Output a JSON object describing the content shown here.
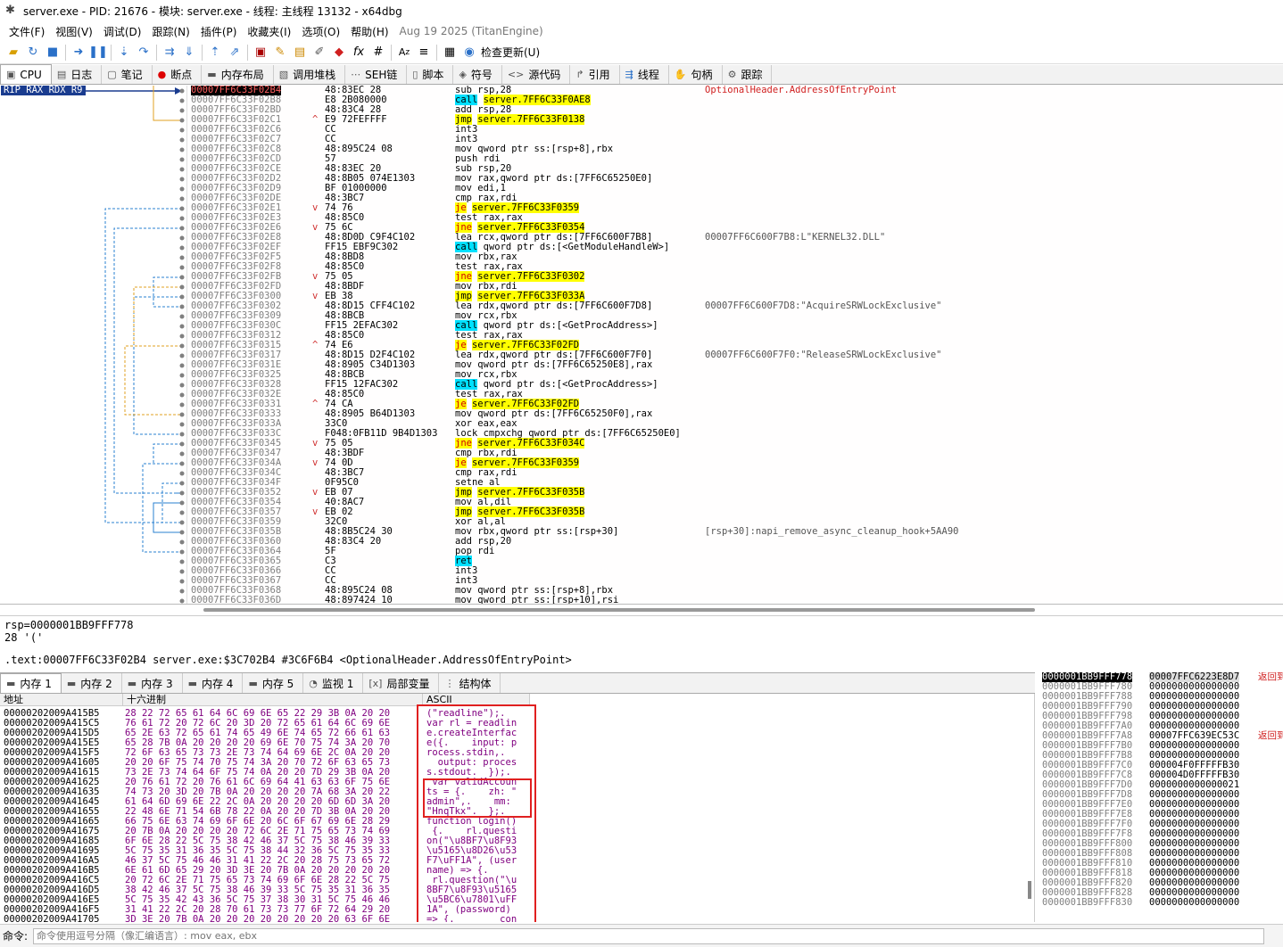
{
  "window": {
    "title": "server.exe - PID: 21676 - 模块: server.exe - 线程: 主线程 13132 - x64dbg"
  },
  "menu": {
    "items": [
      "文件(F)",
      "视图(V)",
      "调试(D)",
      "跟踪(N)",
      "插件(P)",
      "收藏夹(I)",
      "选项(O)",
      "帮助(H)"
    ],
    "build": "Aug 19 2025 (TitanEngine)"
  },
  "toolbar": {
    "check_update_label": "检查更新(U)"
  },
  "tabs": [
    "CPU",
    "日志",
    "笔记",
    "断点",
    "内存布局",
    "调用堆栈",
    "SEH链",
    "脚本",
    "符号",
    "源代码",
    "引用",
    "线程",
    "句柄",
    "跟踪"
  ],
  "disasm": {
    "reg_badge": "RIP RAX RDX R9",
    "lines": [
      {
        "addr": "00007FF6C33F02B4",
        "mark": "",
        "bytes": "48:83EC 28",
        "op": "sub",
        "ops": "rsp,28",
        "cls": "",
        "cmt": "OptionalHeader.AddressOfEntryPoint",
        "cur": true
      },
      {
        "addr": "00007FF6C33F02B8",
        "mark": "",
        "bytes": "E8 2B080000",
        "op": "call",
        "ops": "server.7FF6C33F0AE8",
        "cls": "call",
        "cmt": ""
      },
      {
        "addr": "00007FF6C33F02BD",
        "mark": "",
        "bytes": "48:83C4 28",
        "op": "add",
        "ops": "rsp,28",
        "cls": "",
        "cmt": ""
      },
      {
        "addr": "00007FF6C33F02C1",
        "mark": "^",
        "bytes": "E9 72FEFFFF",
        "op": "jmp",
        "ops": "server.7FF6C33F0138",
        "cls": "jmp",
        "cmt": ""
      },
      {
        "addr": "00007FF6C33F02C6",
        "mark": "",
        "bytes": "CC",
        "op": "int3",
        "ops": "",
        "cls": "",
        "cmt": ""
      },
      {
        "addr": "00007FF6C33F02C7",
        "mark": "",
        "bytes": "CC",
        "op": "int3",
        "ops": "",
        "cls": "",
        "cmt": ""
      },
      {
        "addr": "00007FF6C33F02C8",
        "mark": "",
        "bytes": "48:895C24 08",
        "op": "mov",
        "ops": "qword ptr ss:[rsp+8],rbx",
        "cls": "",
        "cmt": ""
      },
      {
        "addr": "00007FF6C33F02CD",
        "mark": "",
        "bytes": "57",
        "op": "push",
        "ops": "rdi",
        "cls": "",
        "cmt": ""
      },
      {
        "addr": "00007FF6C33F02CE",
        "mark": "",
        "bytes": "48:83EC 20",
        "op": "sub",
        "ops": "rsp,20",
        "cls": "",
        "cmt": ""
      },
      {
        "addr": "00007FF6C33F02D2",
        "mark": "",
        "bytes": "48:8B05 074E1303",
        "op": "mov",
        "ops": "rax,qword ptr ds:[7FF6C65250E0]",
        "cls": "",
        "cmt": ""
      },
      {
        "addr": "00007FF6C33F02D9",
        "mark": "",
        "bytes": "BF 01000000",
        "op": "mov",
        "ops": "edi,1",
        "cls": "",
        "cmt": ""
      },
      {
        "addr": "00007FF6C33F02DE",
        "mark": "",
        "bytes": "48:3BC7",
        "op": "cmp",
        "ops": "rax,rdi",
        "cls": "",
        "cmt": ""
      },
      {
        "addr": "00007FF6C33F02E1",
        "mark": "v",
        "bytes": "74 76",
        "op": "je",
        "ops": "server.7FF6C33F0359",
        "cls": "jcc",
        "cmt": ""
      },
      {
        "addr": "00007FF6C33F02E3",
        "mark": "",
        "bytes": "48:85C0",
        "op": "test",
        "ops": "rax,rax",
        "cls": "",
        "cmt": ""
      },
      {
        "addr": "00007FF6C33F02E6",
        "mark": "v",
        "bytes": "75 6C",
        "op": "jne",
        "ops": "server.7FF6C33F0354",
        "cls": "jcc",
        "cmt": ""
      },
      {
        "addr": "00007FF6C33F02E8",
        "mark": "",
        "bytes": "48:8D0D C9F4C102",
        "op": "lea",
        "ops": "rcx,qword ptr ds:[7FF6C600F7B8]",
        "cls": "",
        "cmt": "00007FF6C600F7B8:L\"KERNEL32.DLL\""
      },
      {
        "addr": "00007FF6C33F02EF",
        "mark": "",
        "bytes": "FF15 EBF9C302",
        "op": "call",
        "ops": "qword ptr ds:[<GetModuleHandleW>]",
        "cls": "callind",
        "cmt": ""
      },
      {
        "addr": "00007FF6C33F02F5",
        "mark": "",
        "bytes": "48:8BD8",
        "op": "mov",
        "ops": "rbx,rax",
        "cls": "",
        "cmt": ""
      },
      {
        "addr": "00007FF6C33F02F8",
        "mark": "",
        "bytes": "48:85C0",
        "op": "test",
        "ops": "rax,rax",
        "cls": "",
        "cmt": ""
      },
      {
        "addr": "00007FF6C33F02FB",
        "mark": "v",
        "bytes": "75 05",
        "op": "jne",
        "ops": "server.7FF6C33F0302",
        "cls": "jcc",
        "cmt": ""
      },
      {
        "addr": "00007FF6C33F02FD",
        "mark": "",
        "bytes": "48:8BDF",
        "op": "mov",
        "ops": "rbx,rdi",
        "cls": "",
        "cmt": ""
      },
      {
        "addr": "00007FF6C33F0300",
        "mark": "v",
        "bytes": "EB 38",
        "op": "jmp",
        "ops": "server.7FF6C33F033A",
        "cls": "jmp",
        "cmt": ""
      },
      {
        "addr": "00007FF6C33F0302",
        "mark": "",
        "bytes": "48:8D15 CFF4C102",
        "op": "lea",
        "ops": "rdx,qword ptr ds:[7FF6C600F7D8]",
        "cls": "",
        "cmt": "00007FF6C600F7D8:\"AcquireSRWLockExclusive\""
      },
      {
        "addr": "00007FF6C33F0309",
        "mark": "",
        "bytes": "48:8BCB",
        "op": "mov",
        "ops": "rcx,rbx",
        "cls": "",
        "cmt": ""
      },
      {
        "addr": "00007FF6C33F030C",
        "mark": "",
        "bytes": "FF15 2EFAC302",
        "op": "call",
        "ops": "qword ptr ds:[<GetProcAddress>]",
        "cls": "callind",
        "cmt": ""
      },
      {
        "addr": "00007FF6C33F0312",
        "mark": "",
        "bytes": "48:85C0",
        "op": "test",
        "ops": "rax,rax",
        "cls": "",
        "cmt": ""
      },
      {
        "addr": "00007FF6C33F0315",
        "mark": "^",
        "bytes": "74 E6",
        "op": "je",
        "ops": "server.7FF6C33F02FD",
        "cls": "jcc",
        "cmt": ""
      },
      {
        "addr": "00007FF6C33F0317",
        "mark": "",
        "bytes": "48:8D15 D2F4C102",
        "op": "lea",
        "ops": "rdx,qword ptr ds:[7FF6C600F7F0]",
        "cls": "",
        "cmt": "00007FF6C600F7F0:\"ReleaseSRWLockExclusive\""
      },
      {
        "addr": "00007FF6C33F031E",
        "mark": "",
        "bytes": "48:8905 C34D1303",
        "op": "mov",
        "ops": "qword ptr ds:[7FF6C65250E8],rax",
        "cls": "",
        "cmt": ""
      },
      {
        "addr": "00007FF6C33F0325",
        "mark": "",
        "bytes": "48:8BCB",
        "op": "mov",
        "ops": "rcx,rbx",
        "cls": "",
        "cmt": ""
      },
      {
        "addr": "00007FF6C33F0328",
        "mark": "",
        "bytes": "FF15 12FAC302",
        "op": "call",
        "ops": "qword ptr ds:[<GetProcAddress>]",
        "cls": "callind",
        "cmt": ""
      },
      {
        "addr": "00007FF6C33F032E",
        "mark": "",
        "bytes": "48:85C0",
        "op": "test",
        "ops": "rax,rax",
        "cls": "",
        "cmt": ""
      },
      {
        "addr": "00007FF6C33F0331",
        "mark": "^",
        "bytes": "74 CA",
        "op": "je",
        "ops": "server.7FF6C33F02FD",
        "cls": "jcc",
        "cmt": ""
      },
      {
        "addr": "00007FF6C33F0333",
        "mark": "",
        "bytes": "48:8905 B64D1303",
        "op": "mov",
        "ops": "qword ptr ds:[7FF6C65250F0],rax",
        "cls": "",
        "cmt": ""
      },
      {
        "addr": "00007FF6C33F033A",
        "mark": "",
        "bytes": "33C0",
        "op": "xor",
        "ops": "eax,eax",
        "cls": "",
        "cmt": ""
      },
      {
        "addr": "00007FF6C33F033C",
        "mark": "",
        "bytes": "F048:0FB11D 9B4D1303",
        "op": "lock cmpxchg",
        "ops": "qword ptr ds:[7FF6C65250E0]",
        "cls": "",
        "cmt": ""
      },
      {
        "addr": "00007FF6C33F0345",
        "mark": "v",
        "bytes": "75 05",
        "op": "jne",
        "ops": "server.7FF6C33F034C",
        "cls": "jcc",
        "cmt": ""
      },
      {
        "addr": "00007FF6C33F0347",
        "mark": "",
        "bytes": "48:3BDF",
        "op": "cmp",
        "ops": "rbx,rdi",
        "cls": "",
        "cmt": ""
      },
      {
        "addr": "00007FF6C33F034A",
        "mark": "v",
        "bytes": "74 0D",
        "op": "je",
        "ops": "server.7FF6C33F0359",
        "cls": "jcc",
        "cmt": ""
      },
      {
        "addr": "00007FF6C33F034C",
        "mark": "",
        "bytes": "48:3BC7",
        "op": "cmp",
        "ops": "rax,rdi",
        "cls": "",
        "cmt": ""
      },
      {
        "addr": "00007FF6C33F034F",
        "mark": "",
        "bytes": "0F95C0",
        "op": "setne",
        "ops": "al",
        "cls": "",
        "cmt": ""
      },
      {
        "addr": "00007FF6C33F0352",
        "mark": "v",
        "bytes": "EB 07",
        "op": "jmp",
        "ops": "server.7FF6C33F035B",
        "cls": "jmp",
        "cmt": ""
      },
      {
        "addr": "00007FF6C33F0354",
        "mark": "",
        "bytes": "40:8AC7",
        "op": "mov",
        "ops": "al,dil",
        "cls": "",
        "cmt": ""
      },
      {
        "addr": "00007FF6C33F0357",
        "mark": "v",
        "bytes": "EB 02",
        "op": "jmp",
        "ops": "server.7FF6C33F035B",
        "cls": "jmp",
        "cmt": ""
      },
      {
        "addr": "00007FF6C33F0359",
        "mark": "",
        "bytes": "32C0",
        "op": "xor",
        "ops": "al,al",
        "cls": "",
        "cmt": ""
      },
      {
        "addr": "00007FF6C33F035B",
        "mark": "",
        "bytes": "48:8B5C24 30",
        "op": "mov",
        "ops": "rbx,qword ptr ss:[rsp+30]",
        "cls": "",
        "cmt": "[rsp+30]:napi_remove_async_cleanup_hook+5AA90"
      },
      {
        "addr": "00007FF6C33F0360",
        "mark": "",
        "bytes": "48:83C4 20",
        "op": "add",
        "ops": "rsp,20",
        "cls": "",
        "cmt": ""
      },
      {
        "addr": "00007FF6C33F0364",
        "mark": "",
        "bytes": "5F",
        "op": "pop",
        "ops": "rdi",
        "cls": "",
        "cmt": ""
      },
      {
        "addr": "00007FF6C33F0365",
        "mark": "",
        "bytes": "C3",
        "op": "ret",
        "ops": "",
        "cls": "ret",
        "cmt": ""
      },
      {
        "addr": "00007FF6C33F0366",
        "mark": "",
        "bytes": "CC",
        "op": "int3",
        "ops": "",
        "cls": "",
        "cmt": ""
      },
      {
        "addr": "00007FF6C33F0367",
        "mark": "",
        "bytes": "CC",
        "op": "int3",
        "ops": "",
        "cls": "",
        "cmt": ""
      },
      {
        "addr": "00007FF6C33F0368",
        "mark": "",
        "bytes": "48:895C24 08",
        "op": "mov",
        "ops": "qword ptr ss:[rsp+8],rbx",
        "cls": "",
        "cmt": ""
      },
      {
        "addr": "00007FF6C33F036D",
        "mark": "",
        "bytes": "48:897424 10",
        "op": "mov",
        "ops": "qword ptr ss:[rsp+10],rsi",
        "cls": "",
        "cmt": ""
      }
    ]
  },
  "info": {
    "line1": "rsp=0000001BB9FFF778",
    "line2": "28 '('",
    "line3": ".text:00007FF6C33F02B4 server.exe:$3C702B4 #3C6F6B4 <OptionalHeader.AddressOfEntryPoint>"
  },
  "bottom_tabs": [
    "内存 1",
    "内存 2",
    "内存 3",
    "内存 4",
    "内存 5",
    "监视 1",
    "局部变量",
    "结构体"
  ],
  "dump": {
    "headers": {
      "addr": "地址",
      "hex": "十六进制",
      "ascii": "ASCII"
    },
    "rows": [
      {
        "a": "00000202009A415B5",
        "h": "28 22 72 65 61 64 6C 69 6E 65 22 29 3B 0A 20 20",
        "s": "(\"readline\");."
      },
      {
        "a": "00000202009A415C5",
        "h": "76 61 72 20 72 6C 20 3D 20 72 65 61 64 6C 69 6E",
        "s": "var rl = readlin"
      },
      {
        "a": "00000202009A415D5",
        "h": "65 2E 63 72 65 61 74 65 49 6E 74 65 72 66 61 63",
        "s": "e.createInterfac"
      },
      {
        "a": "00000202009A415E5",
        "h": "65 28 7B 0A 20 20 20 20 69 6E 70 75 74 3A 20 70",
        "s": "e({.    input: p"
      },
      {
        "a": "00000202009A415F5",
        "h": "72 6F 63 65 73 73 2E 73 74 64 69 6E 2C 0A 20 20",
        "s": "rocess.stdin,.  "
      },
      {
        "a": "00000202009A41605",
        "h": "20 20 6F 75 74 70 75 74 3A 20 70 72 6F 63 65 73",
        "s": "  output: proces"
      },
      {
        "a": "00000202009A41615",
        "h": "73 2E 73 74 64 6F 75 74 0A 20 20 7D 29 3B 0A 20",
        "s": "s.stdout.  });. "
      },
      {
        "a": "00000202009A41625",
        "h": "20 76 61 72 20 76 61 6C 69 64 41 63 63 6F 75 6E",
        "s": " var validAccoun"
      },
      {
        "a": "00000202009A41635",
        "h": "74 73 20 3D 20 7B 0A 20 20 20 20 7A 68 3A 20 22",
        "s": "ts = {.    zh: \""
      },
      {
        "a": "00000202009A41645",
        "h": "61 64 6D 69 6E 22 2C 0A 20 20 20 20 6D 6D 3A 20",
        "s": "admin\",.    mm: "
      },
      {
        "a": "00000202009A41655",
        "h": "22 48 6E 71 54 6B 78 22 0A 20 20 7D 3B 0A 20 20",
        "s": "\"HnqTkx\".  };.  "
      },
      {
        "a": "00000202009A41665",
        "h": "66 75 6E 63 74 69 6F 6E 20 6C 6F 67 69 6E 28 29",
        "s": "function login()"
      },
      {
        "a": "00000202009A41675",
        "h": "20 7B 0A 20 20 20 20 72 6C 2E 71 75 65 73 74 69",
        "s": " {.    rl.questi"
      },
      {
        "a": "00000202009A41685",
        "h": "6F 6E 28 22 5C 75 38 42 46 37 5C 75 38 46 39 33",
        "s": "on(\"\\u8BF7\\u8F93"
      },
      {
        "a": "00000202009A41695",
        "h": "5C 75 35 31 36 35 5C 75 38 44 32 36 5C 75 35 33",
        "s": "\\u5165\\u8D26\\u53"
      },
      {
        "a": "00000202009A416A5",
        "h": "46 37 5C 75 46 46 31 41 22 2C 20 28 75 73 65 72",
        "s": "F7\\uFF1A\", (user"
      },
      {
        "a": "00000202009A416B5",
        "h": "6E 61 6D 65 29 20 3D 3E 20 7B 0A 20 20 20 20 20",
        "s": "name) => {.     "
      },
      {
        "a": "00000202009A416C5",
        "h": "20 72 6C 2E 71 75 65 73 74 69 6F 6E 28 22 5C 75",
        "s": " rl.question(\"\\u"
      },
      {
        "a": "00000202009A416D5",
        "h": "38 42 46 37 5C 75 38 46 39 33 5C 75 35 31 36 35",
        "s": "8BF7\\u8F93\\u5165"
      },
      {
        "a": "00000202009A416E5",
        "h": "5C 75 35 42 43 36 5C 75 37 38 30 31 5C 75 46 46",
        "s": "\\u5BC6\\u7801\\uFF"
      },
      {
        "a": "00000202009A416F5",
        "h": "31 41 22 2C 20 28 70 61 73 73 77 6F 72 64 29 20",
        "s": "1A\", (password) "
      },
      {
        "a": "00000202009A41705",
        "h": "3D 3E 20 7B 0A 20 20 20 20 20 20 20 20 63 6F 6E",
        "s": "=> {.        con"
      }
    ]
  },
  "stack": {
    "rows": [
      {
        "a": "0000001BB9FFF778",
        "v": "00007FFC6223E8D7",
        "c": "返回到"
      },
      {
        "a": "0000001BB9FFF780",
        "v": "0000000000000000",
        "c": ""
      },
      {
        "a": "0000001BB9FFF788",
        "v": "0000000000000000",
        "c": ""
      },
      {
        "a": "0000001BB9FFF790",
        "v": "0000000000000000",
        "c": ""
      },
      {
        "a": "0000001BB9FFF798",
        "v": "0000000000000000",
        "c": ""
      },
      {
        "a": "0000001BB9FFF7A0",
        "v": "0000000000000000",
        "c": ""
      },
      {
        "a": "0000001BB9FFF7A8",
        "v": "00007FFC639EC53C",
        "c": "返回到"
      },
      {
        "a": "0000001BB9FFF7B0",
        "v": "0000000000000000",
        "c": ""
      },
      {
        "a": "0000001BB9FFF7B8",
        "v": "0000000000000000",
        "c": ""
      },
      {
        "a": "0000001BB9FFF7C0",
        "v": "000004F0FFFFFB30",
        "c": ""
      },
      {
        "a": "0000001BB9FFF7C8",
        "v": "000004D0FFFFFB30",
        "c": ""
      },
      {
        "a": "0000001BB9FFF7D0",
        "v": "0000000000000021",
        "c": ""
      },
      {
        "a": "0000001BB9FFF7D8",
        "v": "0000000000000000",
        "c": ""
      },
      {
        "a": "0000001BB9FFF7E0",
        "v": "0000000000000000",
        "c": ""
      },
      {
        "a": "0000001BB9FFF7E8",
        "v": "0000000000000000",
        "c": ""
      },
      {
        "a": "0000001BB9FFF7F0",
        "v": "0000000000000000",
        "c": ""
      },
      {
        "a": "0000001BB9FFF7F8",
        "v": "0000000000000000",
        "c": ""
      },
      {
        "a": "0000001BB9FFF800",
        "v": "0000000000000000",
        "c": ""
      },
      {
        "a": "0000001BB9FFF808",
        "v": "0000000000000000",
        "c": ""
      },
      {
        "a": "0000001BB9FFF810",
        "v": "0000000000000000",
        "c": ""
      },
      {
        "a": "0000001BB9FFF818",
        "v": "0000000000000000",
        "c": ""
      },
      {
        "a": "0000001BB9FFF820",
        "v": "0000000000000000",
        "c": ""
      },
      {
        "a": "0000001BB9FFF828",
        "v": "0000000000000000",
        "c": ""
      },
      {
        "a": "0000001BB9FFF830",
        "v": "0000000000000000",
        "c": ""
      }
    ]
  },
  "command": {
    "label": "命令:",
    "placeholder": "命令使用逗号分隔（像汇编语言）: mov eax, ebx"
  },
  "colors": {
    "call_bg": "#00e0ff",
    "jmp_bg": "#ffff00",
    "jcc_text": "#d00000",
    "badge_bg": "#1a3c8f",
    "highlight_box": "#e02020"
  }
}
